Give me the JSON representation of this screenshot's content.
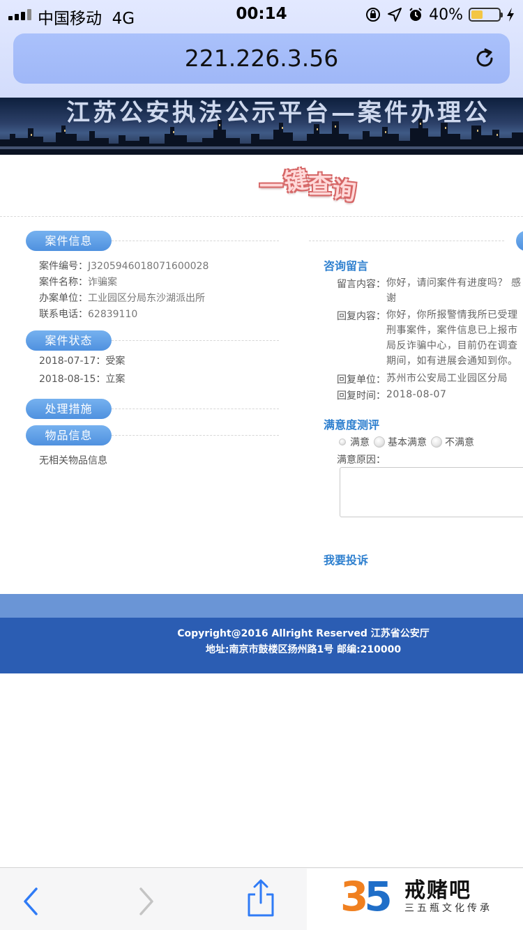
{
  "status_bar": {
    "carrier": "中国移动",
    "network": "4G",
    "time": "00:14",
    "battery": "40%",
    "battery_level": 0.4
  },
  "address_bar": {
    "url": "221.226.3.56"
  },
  "banner": {
    "title": "江苏公安执法公示平台—案件办理公"
  },
  "logo": {
    "chars": [
      "一",
      "键",
      "查",
      "询"
    ]
  },
  "case_info": {
    "section": "案件信息",
    "rows": [
      {
        "label": "案件编号：",
        "value": "J3205946018071600028"
      },
      {
        "label": "案件名称：",
        "value": "诈骗案"
      },
      {
        "label": "办案单位：",
        "value": "工业园区分局东沙湖派出所"
      },
      {
        "label": "联系电话：",
        "value": "62839110"
      }
    ]
  },
  "case_status": {
    "section": "案件状态",
    "rows": [
      {
        "date": "2018-07-17",
        "status": "受案"
      },
      {
        "date": "2018-08-15",
        "status": "立案"
      }
    ]
  },
  "measures": {
    "section": "处理措施"
  },
  "items": {
    "section": "物品信息",
    "text": "无相关物品信息"
  },
  "consult": {
    "heading": "咨询留言",
    "message_label": "留言内容：",
    "message": "你好，请问案件有进度吗？ 感谢",
    "reply_label": "回复内容：",
    "reply": "你好，你所报警情我所已受理刑事案件，案件信息已上报市局反诈骗中心，目前仍在调查期间，如有进展会通知到你。",
    "unit_label": "回复单位：",
    "unit": "苏州市公安局工业园区分局",
    "time_label": "回复时间：",
    "time": "2018-08-07"
  },
  "satisfaction": {
    "heading": "满意度测评",
    "options": [
      "满意",
      "基本满意",
      "不满意"
    ],
    "reason_label": "满意原因："
  },
  "complain": {
    "label": "我要投诉"
  },
  "footer": {
    "copyright": "Copyright@2016 Allright Reserved 江苏省公安厅",
    "address": "地址:南京市鼓楼区扬州路1号 邮编:210000"
  },
  "watermark": {
    "number_a": "3",
    "number_b": "5",
    "name": "戒赌吧",
    "sub": "三五瓶文化传承"
  }
}
